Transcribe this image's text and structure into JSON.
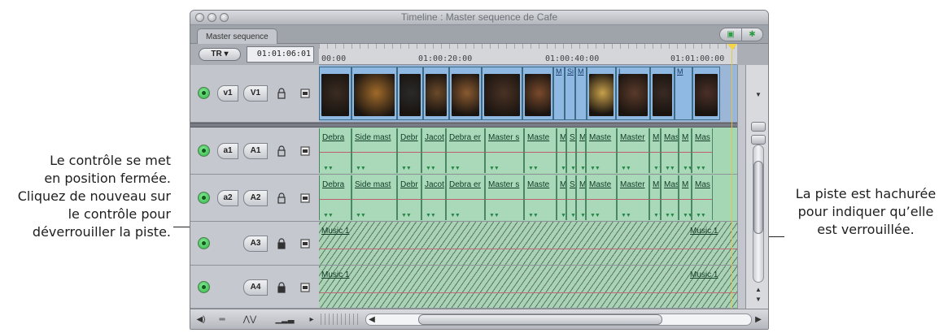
{
  "callouts": {
    "left": [
      "Le contrôle se met",
      "en position fermée.",
      "Cliquez de nouveau sur",
      "le contrôle pour",
      "déverrouiller la piste."
    ],
    "right": [
      "La piste est hachurée",
      "pour indiquer qu’elle",
      "est verrouillée."
    ]
  },
  "window": {
    "title": "Timeline : Master sequence de Cafe",
    "tab_label": "Master sequence",
    "snap_icon": "snapping-icon",
    "linking_icon": "linking-icon"
  },
  "toolbar": {
    "tr_label": "TR",
    "timecode": "01:01:06:01",
    "ruler_ticks": [
      "00:00",
      "01:00:20:00",
      "01:00:40:00",
      "01:01:00:00"
    ]
  },
  "tracks": {
    "v1": {
      "source": "v1",
      "dest": "V1"
    },
    "a1": {
      "source": "a1",
      "dest": "A1"
    },
    "a2": {
      "source": "a2",
      "dest": "A2"
    },
    "a3": {
      "dest": "A3"
    },
    "a4": {
      "dest": "A4"
    }
  },
  "video_clips": [
    "",
    "",
    "",
    "",
    "",
    "",
    "",
    "M",
    "Si",
    "M",
    "",
    "I",
    "",
    "M",
    ""
  ],
  "audio_clips": [
    "Debra",
    "Side mast",
    "Debr",
    "Jacot",
    "Debra er",
    "Master s",
    "Maste",
    "M",
    "Si",
    "M",
    "Maste",
    "Master",
    "M",
    "Mas",
    "M",
    "Mas"
  ],
  "music": {
    "start": "Music 1",
    "end": "Music 1"
  },
  "colors": {
    "accent_green": "#2bab3f",
    "video_clip": "#8fb8e2",
    "audio_clip": "#a9d9b8",
    "playhead": "#f3d547"
  }
}
